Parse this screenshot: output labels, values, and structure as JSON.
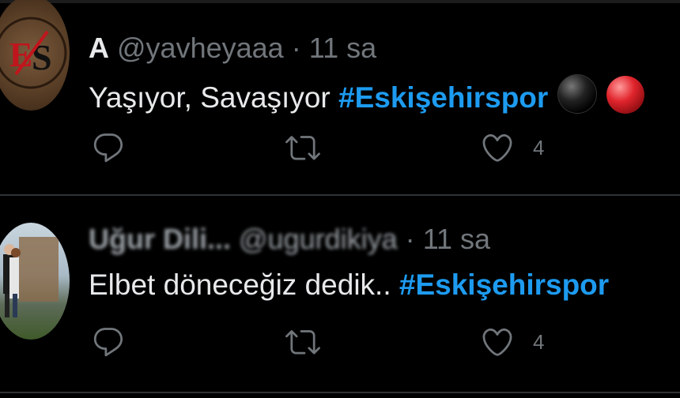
{
  "tweets": [
    {
      "name": "A",
      "handle": "@yavheyaaa",
      "separator": "·",
      "time": "11 sa",
      "text": "Yaşıyor, Savaşıyor ",
      "hashtag": "#Eskişehirspor",
      "emojis": [
        "black-circle-emoji",
        "red-circle-emoji"
      ],
      "like_count": "4"
    },
    {
      "name": "Uğur Dili...",
      "handle": "@ugurdikiya",
      "separator": "·",
      "time": "11 sa",
      "text": "Elbet döneceğiz dedik.. ",
      "hashtag": "#Eskişehirspor",
      "like_count": "4"
    }
  ],
  "colors": {
    "background": "#000000",
    "text": "#e7e9ea",
    "muted": "#71767b",
    "link": "#1d9bf0",
    "divider": "#2f3336"
  },
  "icons": {
    "reply": "reply-icon",
    "retweet": "retweet-icon",
    "like": "heart-icon"
  }
}
